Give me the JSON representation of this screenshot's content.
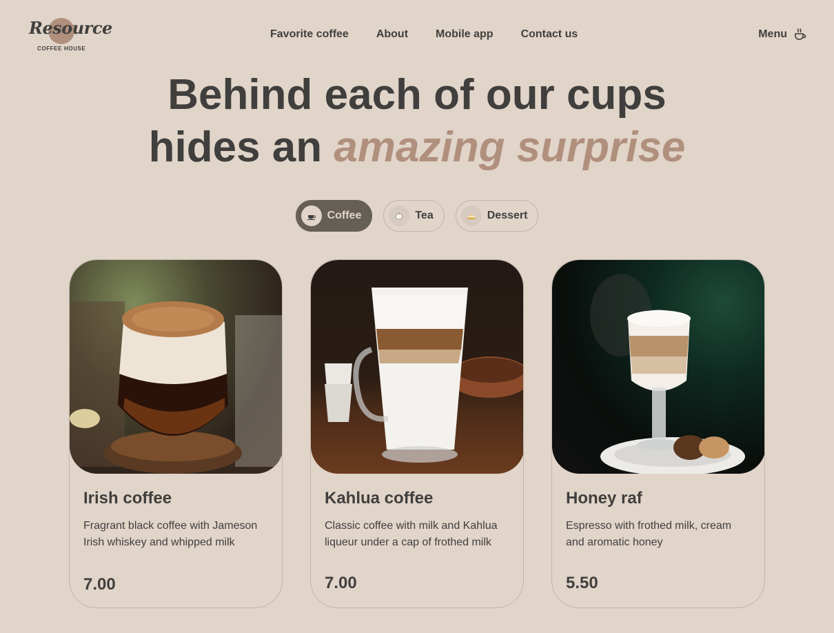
{
  "brand": {
    "logo_script": "Resource",
    "logo_subtitle": "COFFEE HOUSE"
  },
  "nav": {
    "items": [
      {
        "label": "Favorite coffee"
      },
      {
        "label": "About"
      },
      {
        "label": "Mobile app"
      },
      {
        "label": "Contact us"
      }
    ]
  },
  "menu": {
    "label": "Menu",
    "icon": "coffee-cup-icon"
  },
  "headline": {
    "line1": "Behind each of our cups",
    "line2_prefix": "hides an ",
    "line2_accent": "amazing surprise"
  },
  "tabs": [
    {
      "label": "Coffee",
      "icon": "coffee-cup-icon",
      "active": true
    },
    {
      "label": "Tea",
      "icon": "teapot-icon",
      "active": false
    },
    {
      "label": "Dessert",
      "icon": "cake-icon",
      "active": false
    }
  ],
  "products": [
    {
      "title": "Irish coffee",
      "description": "Fragrant black coffee with Jameson Irish whiskey and whipped milk",
      "price": "7.00"
    },
    {
      "title": "Kahlua coffee",
      "description": "Classic coffee with milk and Kahlua liqueur under a cap of frothed milk",
      "price": "7.00"
    },
    {
      "title": "Honey raf",
      "description": "Espresso with frothed milk, cream and aromatic honey",
      "price": "5.50"
    }
  ],
  "colors": {
    "background": "#e1d4c9",
    "text_dark": "#403f3d",
    "accent": "#b0907d",
    "tab_active_bg": "#665f55",
    "border": "#c1b6ad"
  }
}
